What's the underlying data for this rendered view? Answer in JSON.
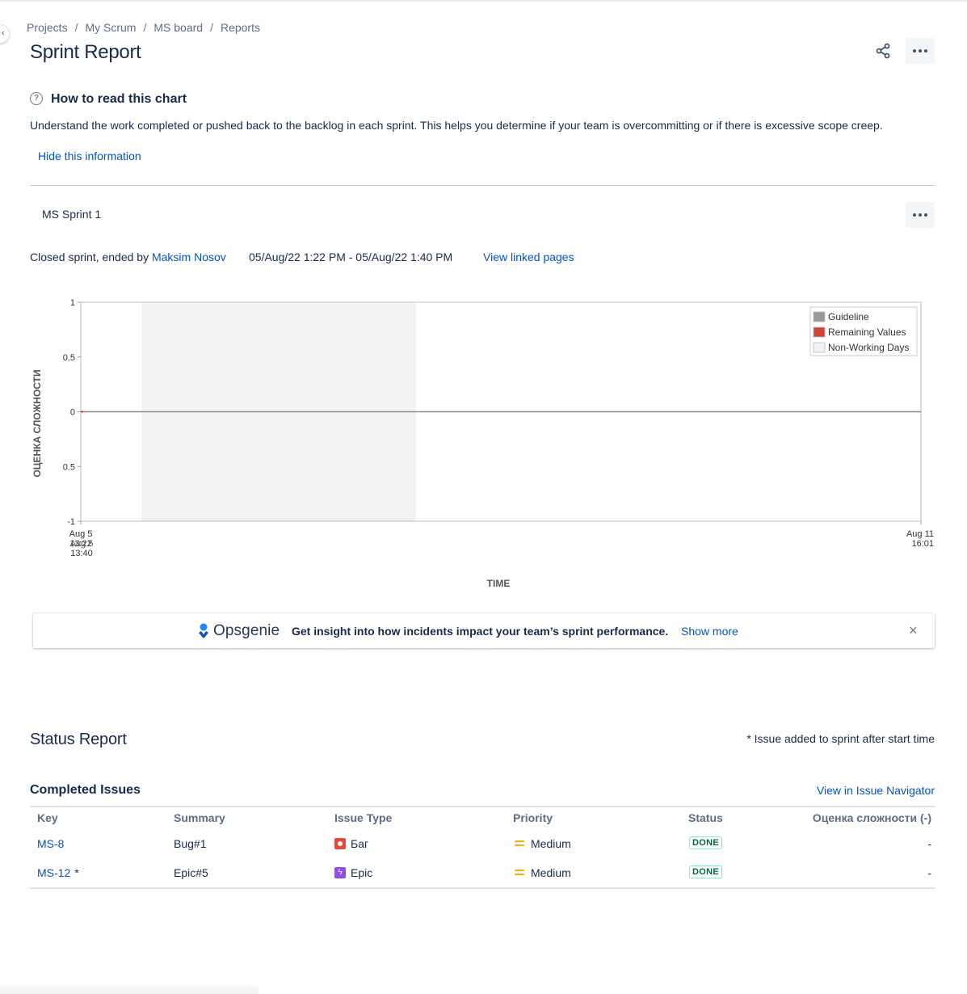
{
  "breadcrumb": [
    "Projects",
    "My Scrum",
    "MS board",
    "Reports"
  ],
  "page_title": "Sprint Report",
  "help": {
    "title": "How to read this chart",
    "text": "Understand the work completed or pushed back to the backlog in each sprint. This helps you determine if your team is overcommitting or if there is excessive scope creep.",
    "hide_link": "Hide this information"
  },
  "sprint": {
    "name": "MS Sprint 1",
    "closed_prefix": "Closed sprint, ended by",
    "ended_by": "Maksim Nosov",
    "dates": "05/Aug/22 1:22 PM - 05/Aug/22 1:40 PM",
    "view_linked": "View linked pages"
  },
  "chart_data": {
    "type": "line",
    "ylabel": "ОЦЕНКА СЛОЖНОСТИ",
    "xlabel": "TIME",
    "ylim": [
      -1,
      1
    ],
    "y_ticks": [
      "1",
      "0.5",
      "0",
      "0.5",
      "-1"
    ],
    "x_ticks": [
      {
        "line1": "Aug 5",
        "line2": "13:22"
      },
      {
        "line1": "Aug 5",
        "line2": "13:40"
      },
      {
        "line1": "Aug 11",
        "line2": "16:01"
      }
    ],
    "legend": [
      "Guideline",
      "Remaining Values",
      "Non-Working Days"
    ],
    "legend_position": "top-right",
    "colors": {
      "guideline": "#999999",
      "remaining": "#d04437",
      "non_working": "#f2f2f2"
    },
    "series": [
      {
        "name": "Guideline",
        "values": [
          0,
          0
        ]
      },
      {
        "name": "Remaining Values",
        "values": [
          0,
          0
        ]
      }
    ]
  },
  "opsgenie": {
    "logo": "Opsgenie",
    "message": "Get insight into how incidents impact your team’s sprint performance.",
    "show_more": "Show more",
    "close": "×"
  },
  "status_report": {
    "title": "Status Report",
    "note": "* Issue added to sprint after start time",
    "completed_title": "Completed Issues",
    "view_navigator": "View in Issue Navigator",
    "columns": [
      "Key",
      "Summary",
      "Issue Type",
      "Priority",
      "Status",
      "Оценка сложности (-)"
    ],
    "rows": [
      {
        "key": "MS-8",
        "added": "",
        "summary": "Bug#1",
        "type": "Баг",
        "type_icon": "bug-icon",
        "priority": "Medium",
        "status": "DONE",
        "estimate": "-"
      },
      {
        "key": "MS-12",
        "added": "*",
        "summary": "Epic#5",
        "type": "Epic",
        "type_icon": "epic-icon",
        "priority": "Medium",
        "status": "DONE",
        "estimate": "-"
      }
    ]
  }
}
